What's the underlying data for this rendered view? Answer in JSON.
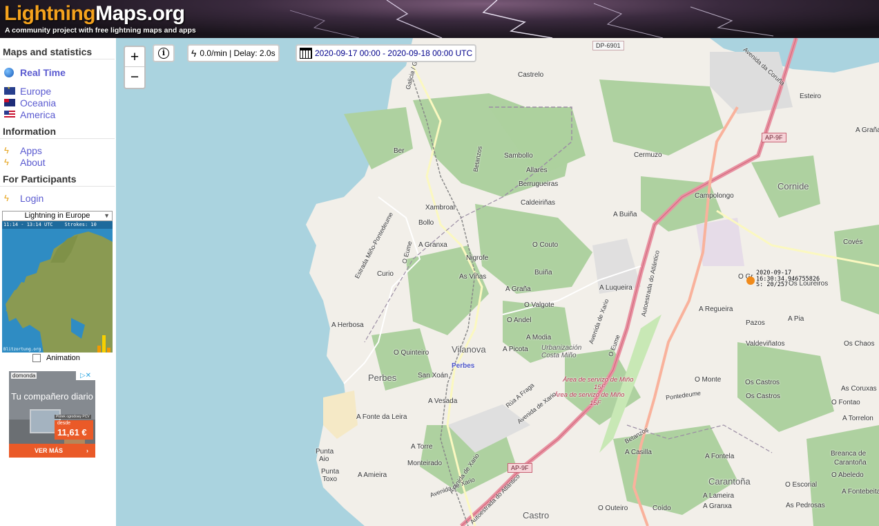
{
  "header": {
    "logo_part1": "Lightning",
    "logo_part2": "Maps.org",
    "tagline": "A community project with free lightning maps and apps"
  },
  "sidebar": {
    "section_maps": "Maps and statistics",
    "real_time": "Real Time",
    "regions": [
      "Europe",
      "Oceania",
      "America"
    ],
    "section_info": "Information",
    "info_items": [
      "Apps",
      "About"
    ],
    "section_participants": "For Participants",
    "login": "Login",
    "select_value": "Lightning in Europe",
    "thumb_header": "11:14 - 13:14 UTC    Strokes: 10",
    "thumb_footer": "Blitzortung.org",
    "animation_label": "Animation"
  },
  "ad": {
    "brand": "domonda",
    "headline": "Tu compañero diario",
    "product_tag": "Plotek ogrodowy PCV",
    "price_prefix": "desde",
    "price": "11,61 €",
    "cta": "VER MÁS",
    "cta_arrow": "›"
  },
  "controls": {
    "zoom_in": "+",
    "zoom_out": "−",
    "info": "i",
    "rate": "0.0/min | Delay: 2.0s",
    "date_range": "2020-09-17 00:00 - 2020-09-18 00:00 UTC"
  },
  "strike": {
    "line1": "2020-09-17",
    "line2": "16:30:34.946755826",
    "line3": "S: 20/257"
  },
  "map_labels": {
    "dp6901": "DP-6901",
    "ap9f_top": "AP-9F",
    "ap9f_bottom": "AP-9F",
    "castrelo": "Castrelo",
    "galicia_galiza": "Galicia / Galiza",
    "avenida_coruna": "Avenida da Coruña",
    "esteiro": "Esteiro",
    "a_grana_tr": "A Graña",
    "cornide": "Cornide",
    "ber": "Ber",
    "betanzos_top": "Betanzos",
    "sambollo": "Sambollo",
    "allares": "Allares",
    "berrugueiras": "Berrugueiras",
    "cermuzo": "Cermuzo",
    "campolongo": "Campolongo",
    "caldeirinas": "Caldeiriñas",
    "xambroal": "Xambroal",
    "bollo": "Bollo",
    "a_buina": "A Buiña",
    "coves": "Covés",
    "estrada": "Estrada Miño-Pontedeume",
    "o_eume_left": "O Eume",
    "a_granxa": "A Granxa",
    "o_couto": "O Couto",
    "nigrofe": "Nigrofe",
    "curio": "Curio",
    "as_vinas": "As Viñas",
    "buina": "Buiña",
    "a_luqueira": "A Luqueira",
    "autoestrada_top": "Autoestrada do Atlántico",
    "o_gr": "O Gr",
    "os_loureiros": "Os Loureiros",
    "a_grana_mid": "A Graña",
    "o_valgote": "O Valgote",
    "avenida_xario": "Avenida de Xario",
    "a_regueira": "A Regueira",
    "a_pia": "A Pia",
    "pazos": "Pazos",
    "o_andel": "O Andel",
    "a_herbosa": "A Herbosa",
    "valdevinatos": "Valdeviñatos",
    "os_chaos": "Os Chaos",
    "a_modia": "A Modia",
    "vilanova": "Vilanova",
    "urbanizacion": "Urbanización Costa Miño",
    "o_quinteiro": "O Quinteiro",
    "a_picota": "A Picota",
    "o_eume_mid": "O Eume",
    "perbes_pin": "Perbes",
    "perbes": "Perbes",
    "san_xoan": "San Xoán",
    "area_servizo_1": "Área de servizo de Miño",
    "area_servizo_1b": "15F",
    "area_servizo_2": "Área de servizo de Miño",
    "area_servizo_2b": "15F",
    "o_monte": "O Monte",
    "os_castros_1": "Os Castros",
    "os_castros_2": "Os Castros",
    "as_coruxas": "As Coruxas",
    "o_fontao": "O Fontao",
    "a_vesada": "A Vesada",
    "rua_a_fraga": "Rúa A Fraga",
    "avenida_xario_2": "Avenida de Xario",
    "pontedeume": "Pontedeume",
    "a_torrelon": "A Torrelon",
    "a_fonte_leira": "A Fonte da Leira",
    "betanzos_bottom": "Betanzos",
    "a_torre": "A Torre",
    "punta_aio_1": "Punta",
    "punta_aio_2": "Aio",
    "a_casilla": "A Casilla",
    "a_fontela": "A Fontela",
    "breanca_1": "Breanca de",
    "breanca_2": "Carantoña",
    "monteirado": "Monteirado",
    "punta_toxo_1": "Punta",
    "punta_toxo_2": "Toxo",
    "a_amieira": "A Amieira",
    "avenida_xario_3": "Avenida de Xario",
    "carantona": "Carantoña",
    "o_abeledo": "O Abeledo",
    "o_escorial": "O Escorial",
    "a_fontebeita": "A Fontebeita",
    "avenida_xario_4": "Avenida de Xario",
    "autoestrada_bottom": "Autoestrada do Atlántico",
    "a_lameira": "A Lameira",
    "castro": "Castro",
    "o_outeiro": "O Outeiro",
    "coido": "Coído",
    "a_granxa_2": "A Granxa",
    "as_pedrosas": "As Pedrosas"
  },
  "colors": {
    "sea": "#aad3df",
    "forest": "#aed1a0",
    "land": "#f2efe9",
    "motorway": "#e892a2",
    "trunk": "#f9b29c",
    "accent_orange": "#f4a21d",
    "link": "#5a5ad0"
  }
}
